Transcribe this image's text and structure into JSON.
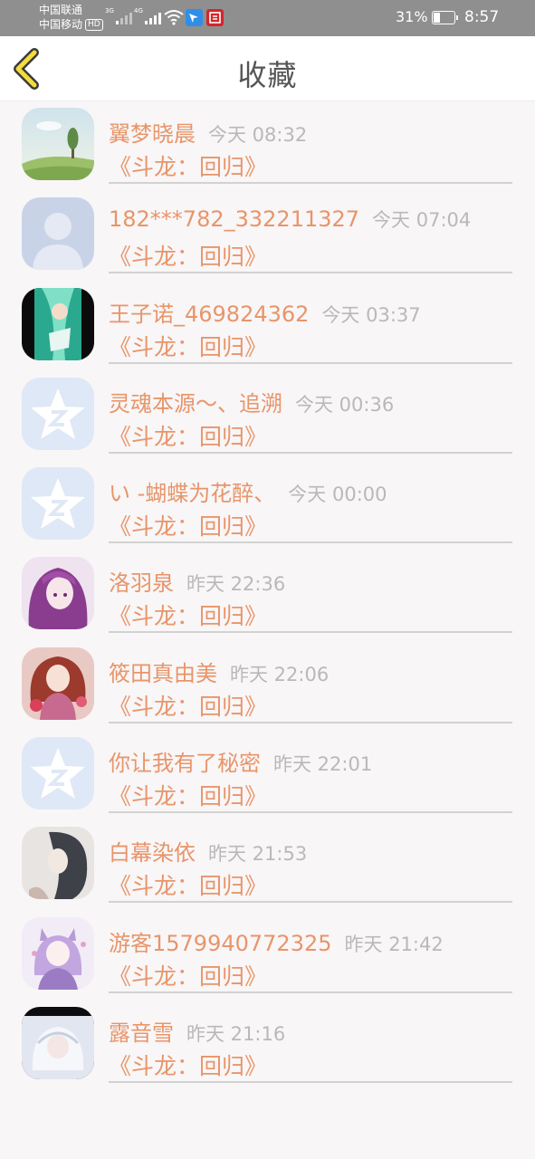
{
  "status_bar": {
    "carrier_1": "中国联通",
    "carrier_2": "中国移动",
    "hd_badge": "HD",
    "net_1": "3G",
    "net_2": "4G",
    "battery_percent": "31%",
    "battery_level": 0.31,
    "time": "8:57"
  },
  "header": {
    "title": "收藏",
    "back_icon": "chevron-left-icon"
  },
  "colors": {
    "accent": "#e8956a",
    "time_gray": "#b9b9b9",
    "back_icon_yellow": "#f3dc3c"
  },
  "favorites": [
    {
      "name": "翼梦晓晨",
      "time": "今天 08:32",
      "book": "《斗龙：回归》",
      "avatar": "landscape-avatar"
    },
    {
      "name": "182***782_332211327",
      "time": "今天 07:04",
      "book": "《斗龙：回归》",
      "avatar": "default-person-avatar"
    },
    {
      "name": "王子诺_469824362",
      "time": "今天 03:37",
      "book": "《斗龙：回归》",
      "avatar": "anime-green-avatar"
    },
    {
      "name": "灵魂本源～、追溯",
      "time": "今天 00:36",
      "book": "《斗龙：回归》",
      "avatar": "qzone-star-avatar"
    },
    {
      "name": "い -蝴蝶为花醉、",
      "time": "今天 00:00",
      "book": "《斗龙：回归》",
      "avatar": "qzone-star-avatar"
    },
    {
      "name": "洛羽泉",
      "time": "昨天 22:36",
      "book": "《斗龙：回归》",
      "avatar": "anime-purple-avatar"
    },
    {
      "name": "筱田真由美",
      "time": "昨天 22:06",
      "book": "《斗龙：回归》",
      "avatar": "anime-red-avatar"
    },
    {
      "name": "你让我有了秘密",
      "time": "昨天 22:01",
      "book": "《斗龙：回归》",
      "avatar": "qzone-star-avatar"
    },
    {
      "name": "白幕染依",
      "time": "昨天 21:53",
      "book": "《斗龙：回归》",
      "avatar": "anime-gray-avatar"
    },
    {
      "name": "游客1579940772325",
      "time": "昨天 21:42",
      "book": "《斗龙：回归》",
      "avatar": "anime-lavender-avatar"
    },
    {
      "name": "露音雪",
      "time": "昨天 21:16",
      "book": "《斗龙：回归》",
      "avatar": "anime-white-avatar"
    }
  ]
}
